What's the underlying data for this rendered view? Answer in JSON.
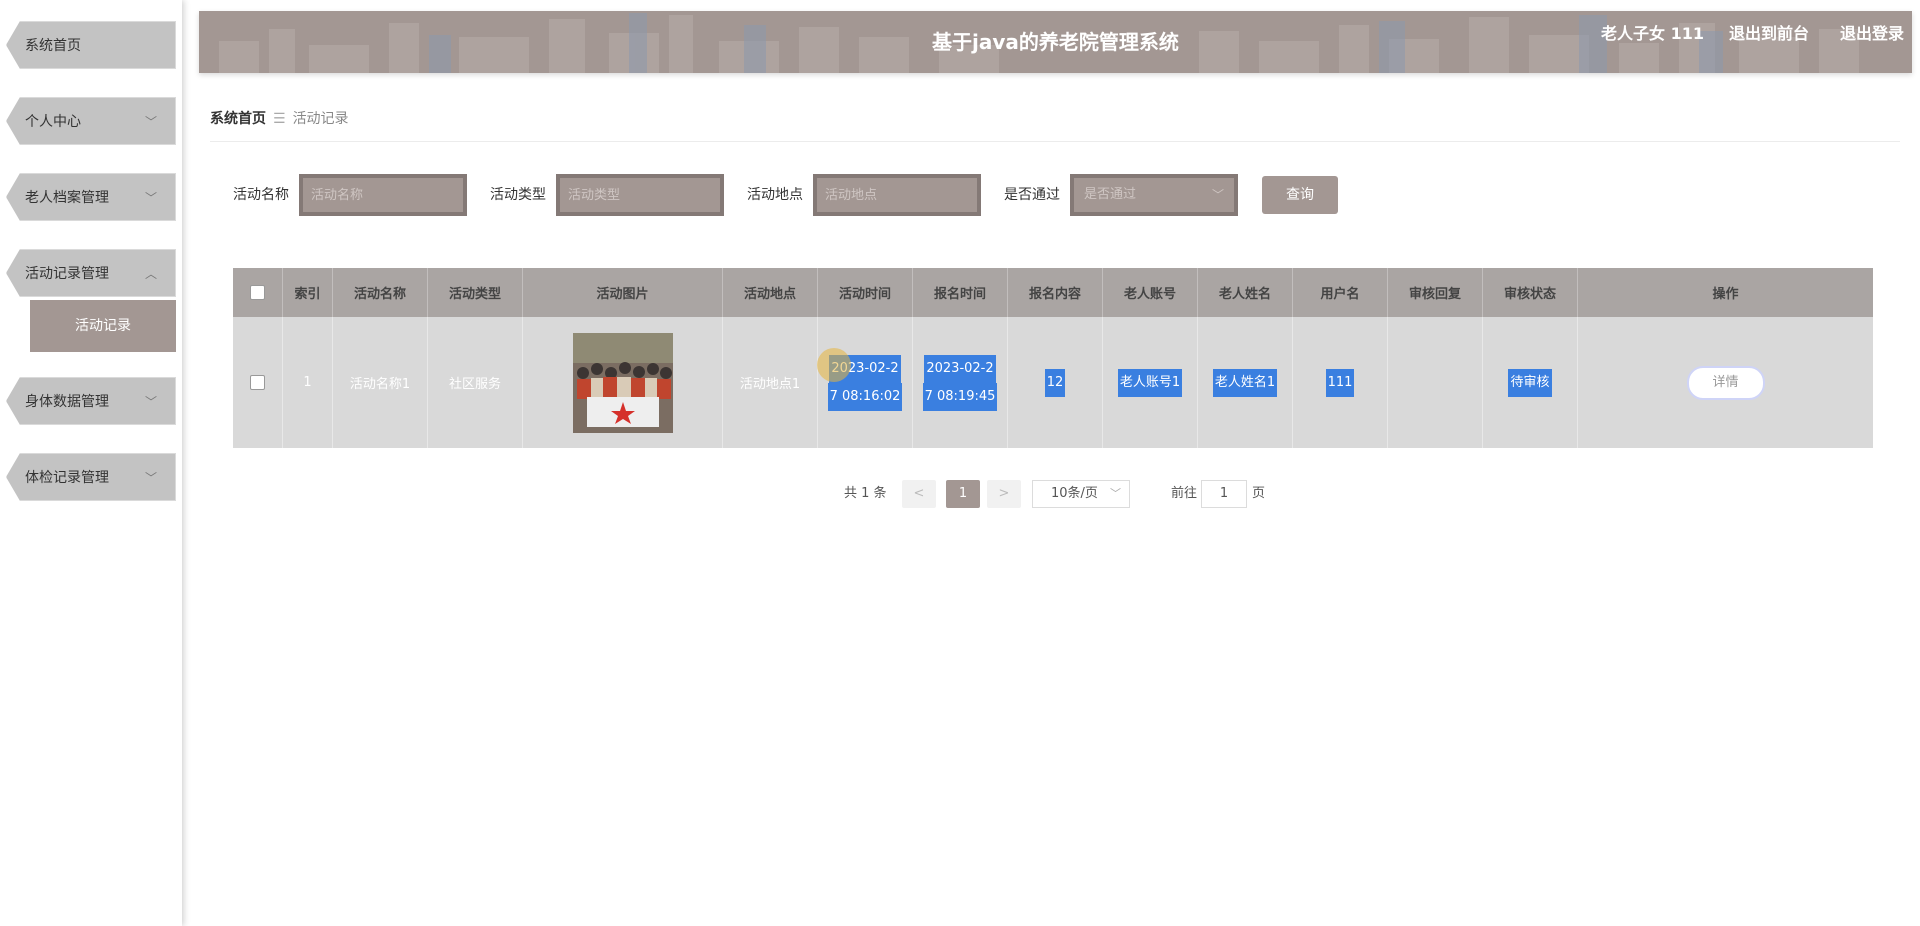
{
  "sidebar": {
    "items": [
      {
        "label": "系统首页",
        "chevron": ""
      },
      {
        "label": "个人中心",
        "chevron": "﹀"
      },
      {
        "label": "老人档案管理",
        "chevron": "﹀"
      },
      {
        "label": "活动记录管理",
        "chevron": "︿"
      },
      {
        "label": "身体数据管理",
        "chevron": "﹀"
      },
      {
        "label": "体检记录管理",
        "chevron": "﹀"
      }
    ],
    "submenu": {
      "label": "活动记录"
    }
  },
  "header": {
    "title": "基于java的养老院管理系统",
    "user": "老人子女 111",
    "front_link": "退出到前台",
    "logout": "退出登录"
  },
  "breadcrumb": {
    "home": "系统首页",
    "separator": "☰",
    "current": "活动记录"
  },
  "search": {
    "fields": [
      {
        "label": "活动名称",
        "placeholder": "活动名称"
      },
      {
        "label": "活动类型",
        "placeholder": "活动类型"
      },
      {
        "label": "活动地点",
        "placeholder": "活动地点"
      },
      {
        "label": "是否通过",
        "placeholder": "是否通过"
      }
    ],
    "query_label": "查询"
  },
  "table": {
    "columns": [
      "",
      "索引",
      "活动名称",
      "活动类型",
      "活动图片",
      "活动地点",
      "活动时间",
      "报名时间",
      "报名内容",
      "老人账号",
      "老人姓名",
      "用户名",
      "审核回复",
      "审核状态",
      "操作"
    ],
    "rows": [
      {
        "index": "1",
        "name": "活动名称1",
        "type": "社区服务",
        "location": "活动地点1",
        "activity_time_1": "2023-02-2",
        "activity_time_2": "7 08:16:02",
        "signup_time_1": "2023-02-2",
        "signup_time_2": "7 08:19:45",
        "content": "12",
        "account": "老人账号1",
        "elder_name": "老人姓名1",
        "username": "111",
        "reply": "",
        "status": "待审核",
        "action": "详情"
      }
    ]
  },
  "pagination": {
    "total": "共 1 条",
    "prev": "<",
    "page": "1",
    "next": ">",
    "size": "10条/页",
    "goto": "前往",
    "goto_value": "1",
    "page_unit": "页"
  },
  "colors": {
    "accent": "#a39793",
    "header_bg": "#a39793",
    "row_bg": "#d9d9d9",
    "selection": "#3a7fe0"
  },
  "icons": {
    "chevron_down": "chevron-down-icon",
    "chevron_up": "chevron-up-icon"
  }
}
